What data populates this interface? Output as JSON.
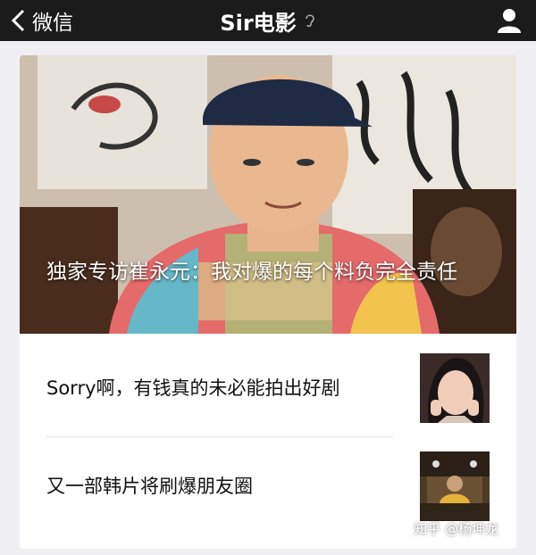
{
  "nav": {
    "back_label": "微信",
    "title": "Sir电影"
  },
  "hero": {
    "headline": "独家专访崔永元：我对爆的每个料负完全责任"
  },
  "articles": [
    {
      "title": "Sorry啊，有钱真的未必能拍出好剧"
    },
    {
      "title": "又一部韩片将刷爆朋友圈"
    }
  ],
  "watermark": "知乎 @杨坤龙",
  "colors": {
    "topbar": "#1b1b1b",
    "background": "#efeff4",
    "card": "#ffffff"
  }
}
